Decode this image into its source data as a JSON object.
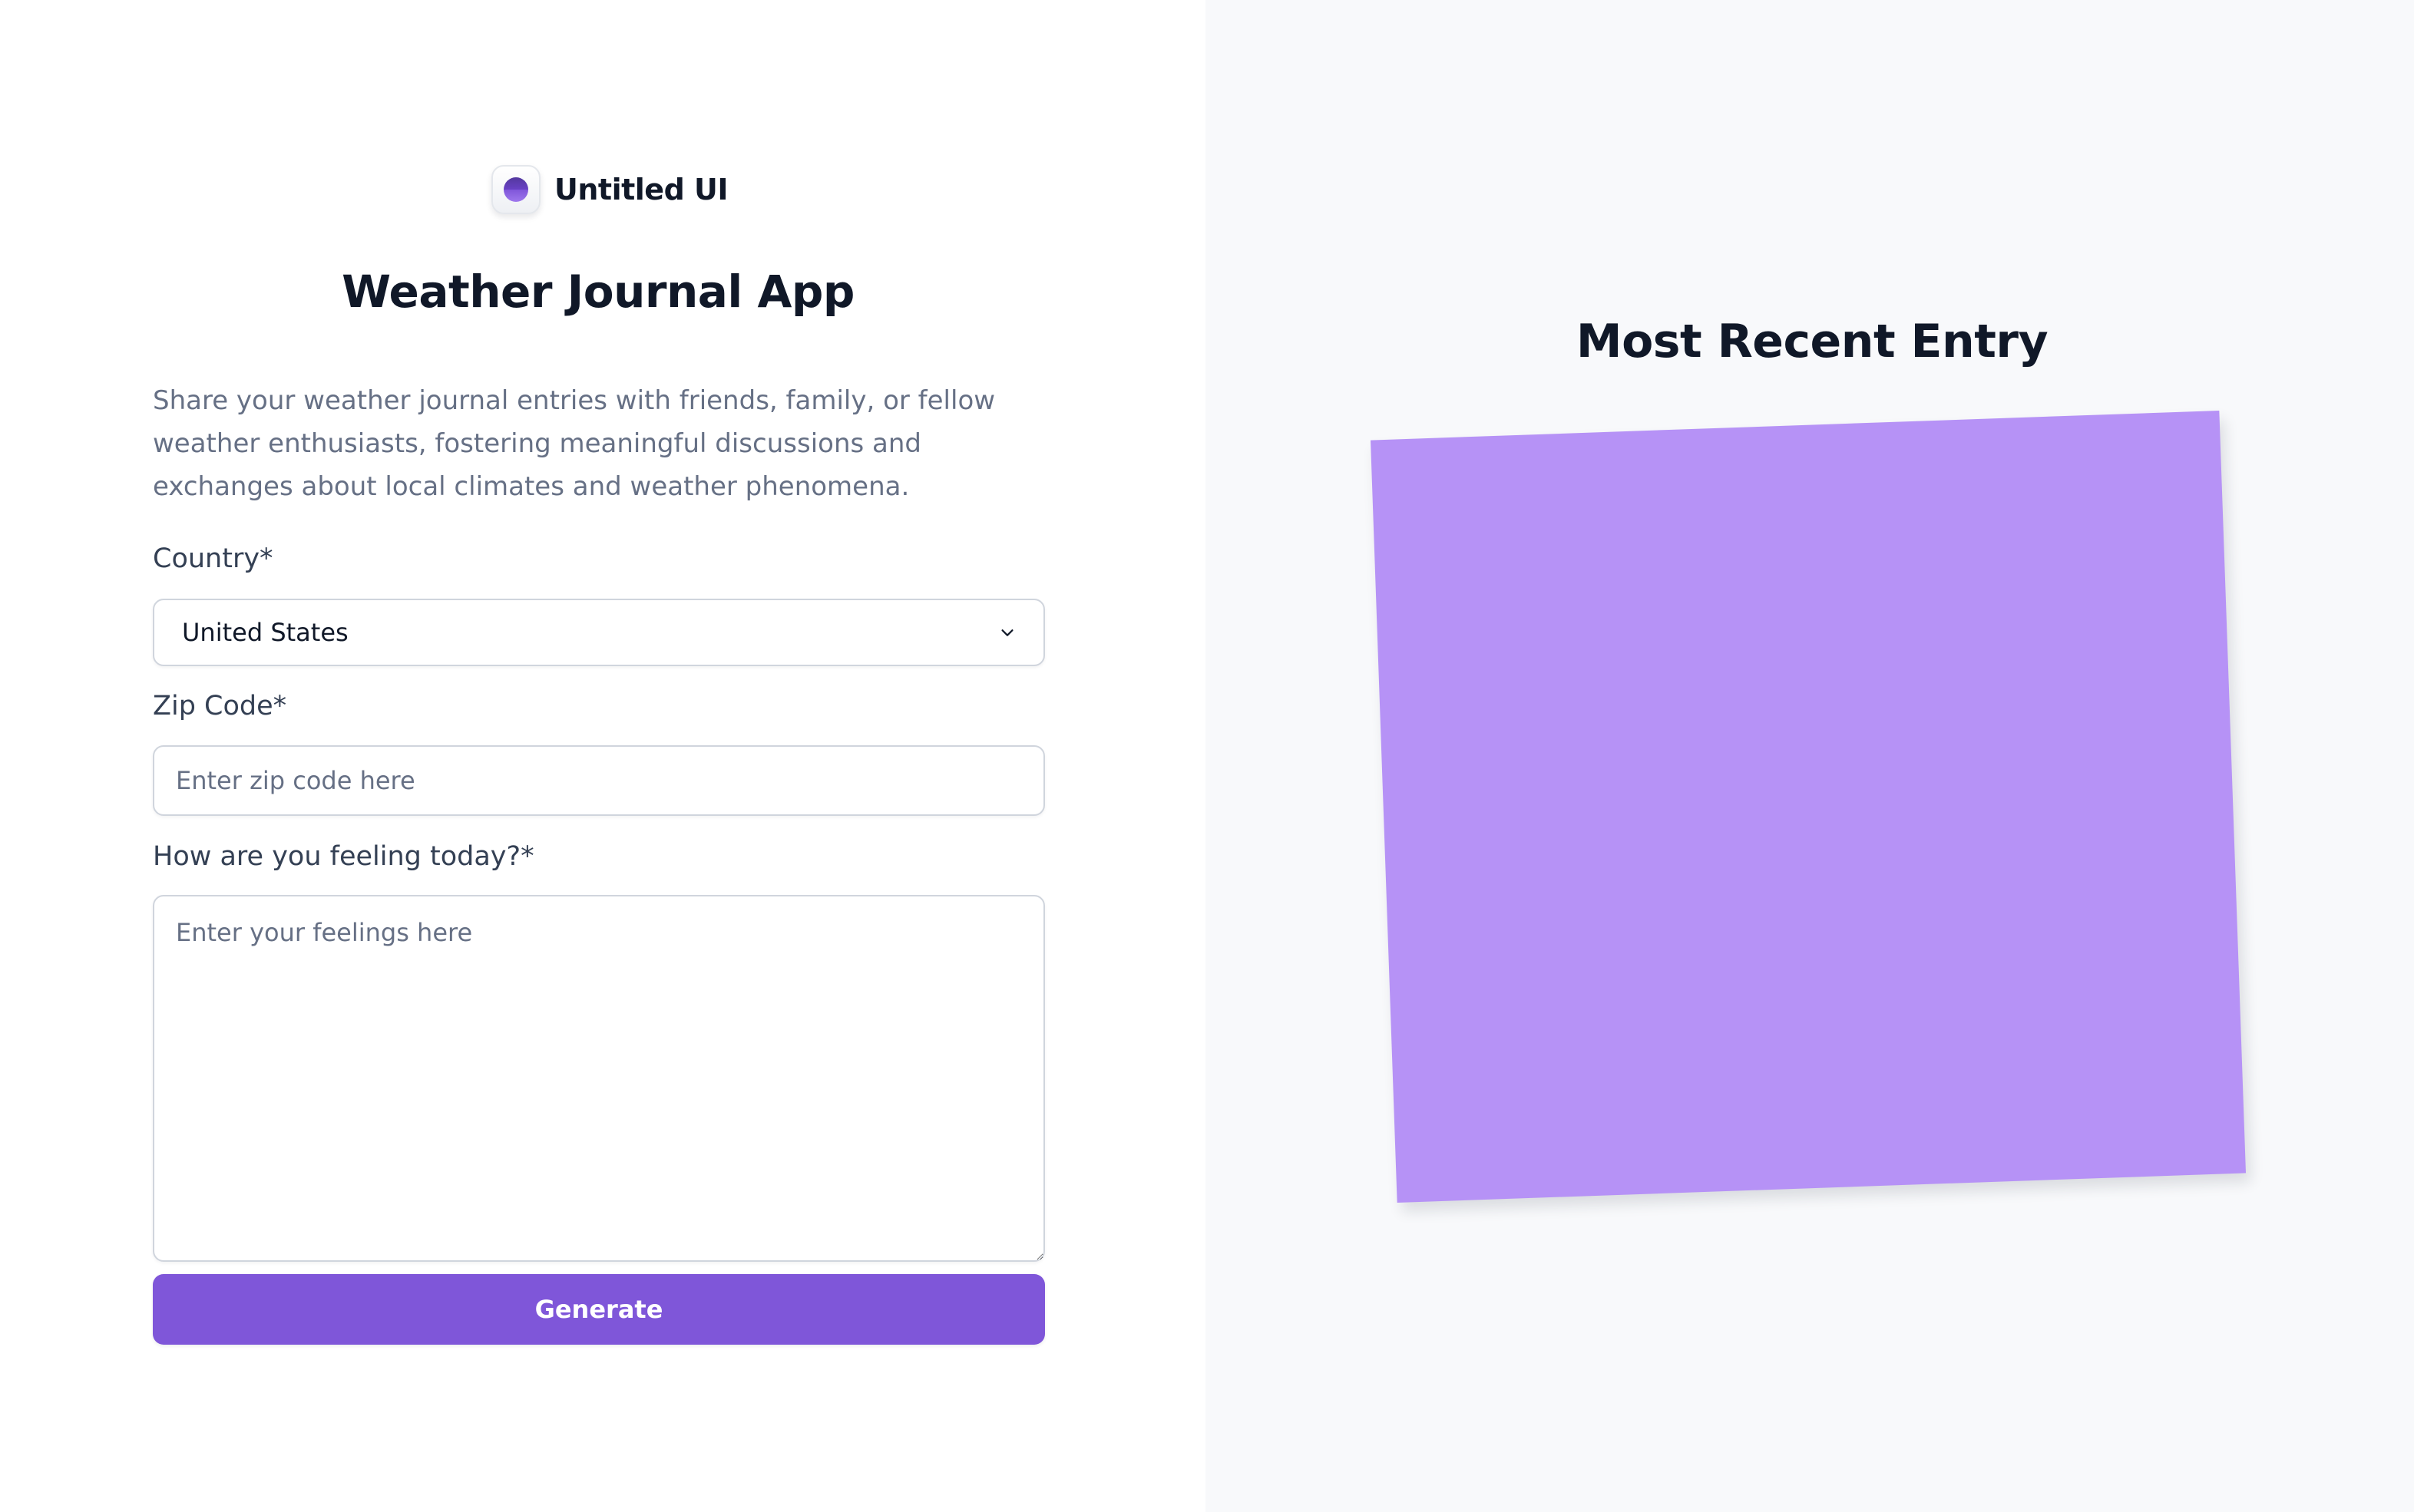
{
  "brand": {
    "name": "Untitled UI",
    "logo_icon": "circle-logo-icon"
  },
  "form": {
    "title": "Weather Journal App",
    "intro": "Share your weather journal entries with friends, family, or fellow weather enthusiasts, fostering meaningful discussions and exchanges about local climates and weather phenomena.",
    "country": {
      "label": "Country*",
      "selected": "United States"
    },
    "zip": {
      "label": "Zip Code*",
      "placeholder": "Enter zip code here",
      "value": ""
    },
    "feelings": {
      "label": "How are you feeling today?*",
      "placeholder": "Enter your feelings here",
      "value": ""
    },
    "submit_label": "Generate"
  },
  "recent": {
    "title": "Most Recent Entry"
  },
  "colors": {
    "accent": "#7f56d9",
    "card": "#b692f6",
    "panel_bg": "#f8f9fb"
  }
}
